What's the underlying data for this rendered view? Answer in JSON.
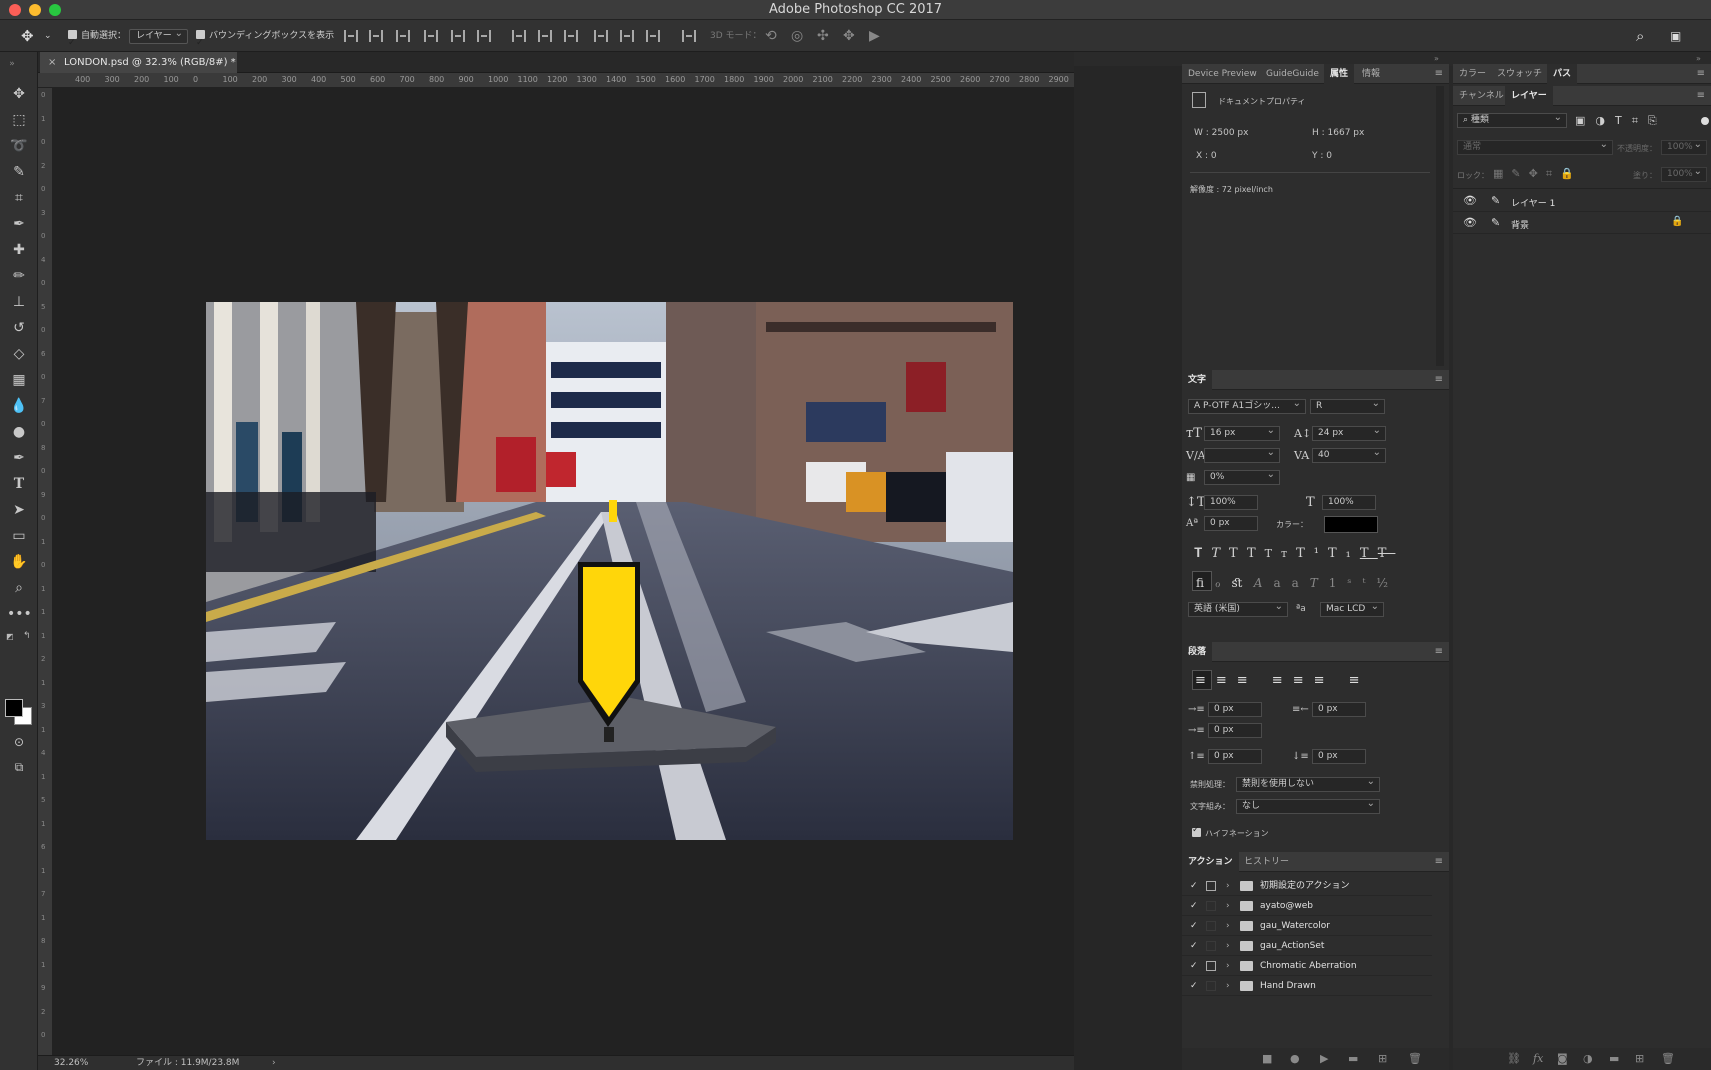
{
  "app": {
    "title": "Adobe Photoshop CC 2017"
  },
  "options": {
    "auto_select_label": "自動選択：",
    "auto_select_value": "レイヤー",
    "bbox_label": "バウンディングボックスを表示",
    "mode3d": "3D モード："
  },
  "document": {
    "tab_title": "LONDON.psd @ 32.3% (RGB/8#) *",
    "zoom": "32.26%",
    "file_info": "ファイル : 11.9M/23.8M"
  },
  "ruler": {
    "h": [
      "400",
      "300",
      "200",
      "100",
      "0",
      "100",
      "200",
      "300",
      "400",
      "500",
      "600",
      "700",
      "800",
      "900",
      "1000",
      "1100",
      "1200",
      "1300",
      "1400",
      "1500",
      "1600",
      "1700",
      "1800",
      "1900",
      "2000",
      "2100",
      "2200",
      "2300",
      "2400",
      "2500",
      "2600",
      "2700",
      "2800",
      "2900"
    ],
    "v": [
      "0",
      "1",
      "0",
      "2",
      "0",
      "3",
      "0",
      "4",
      "0",
      "5",
      "0",
      "6",
      "0",
      "7",
      "0",
      "8",
      "0",
      "9",
      "0",
      "1",
      "0",
      "1",
      "1",
      "1",
      "2",
      "1",
      "3",
      "1",
      "4",
      "1",
      "5",
      "1",
      "6",
      "1",
      "7",
      "1",
      "8",
      "1",
      "9",
      "2",
      "0"
    ]
  },
  "props_panel": {
    "tabs": [
      "Device Preview",
      "GuideGuide",
      "属性",
      "情報"
    ],
    "doc_props": "ドキュメントプロパティ",
    "w": "W : 2500 px",
    "h": "H : 1667 px",
    "x": "X : 0",
    "y": "Y : 0",
    "resolution": "解像度 : 72 pixel/inch"
  },
  "char_panel": {
    "title": "文字",
    "font": "A P-OTF A1ゴシッ...",
    "style": "R",
    "size": "16 px",
    "leading": "24 px",
    "kerning": "",
    "tracking": "40",
    "tsume": "0%",
    "vscale": "100%",
    "hscale": "100%",
    "baseline": "0 px",
    "color_label": "カラー：",
    "lang": "英語 (米国)",
    "aa": "Mac LCD",
    "aa_icon": "ªa"
  },
  "para_panel": {
    "title": "段落",
    "indent_left": "0 px",
    "indent_right": "0 px",
    "indent_first": "0 px",
    "space_before": "0 px",
    "space_after": "0 px",
    "kinsoku_label": "禁則処理：",
    "kinsoku": "禁則を使用しない",
    "mojigumi_label": "文字組み：",
    "mojigumi": "なし",
    "hyphen": "ハイフネーション"
  },
  "actions_panel": {
    "tabs": [
      "アクション",
      "ヒストリー"
    ],
    "items": [
      "初期設定のアクション",
      "ayato@web",
      "gau_Watercolor",
      "gau_ActionSet",
      "Chromatic Aberration",
      "Hand Drawn"
    ]
  },
  "right_panel": {
    "tabs_top": [
      "カラー",
      "スウォッチ",
      "パス"
    ],
    "tabs_mid": [
      "チャンネル",
      "レイヤー"
    ],
    "filter": "種類",
    "blend": "通常",
    "opacity_label": "不透明度：",
    "opacity": "100%",
    "lock_label": "ロック：",
    "fill_label": "塗り：",
    "fill": "100%",
    "layers": [
      "レイヤー 1",
      "背景"
    ]
  },
  "colors": {
    "accent": "#ffd60a",
    "fg": "#000000",
    "bg": "#ffffff"
  },
  "icons": [
    "move-icon",
    "marquee-icon",
    "lasso-icon",
    "magic-wand-icon",
    "crop-icon",
    "eyedropper-icon",
    "healing-icon",
    "brush-icon",
    "stamp-icon",
    "history-brush-icon",
    "eraser-icon",
    "gradient-icon",
    "blur-icon",
    "dodge-icon",
    "pen-icon",
    "type-icon",
    "path-select-icon",
    "rectangle-icon",
    "hand-icon",
    "zoom-icon",
    "more-icon"
  ]
}
